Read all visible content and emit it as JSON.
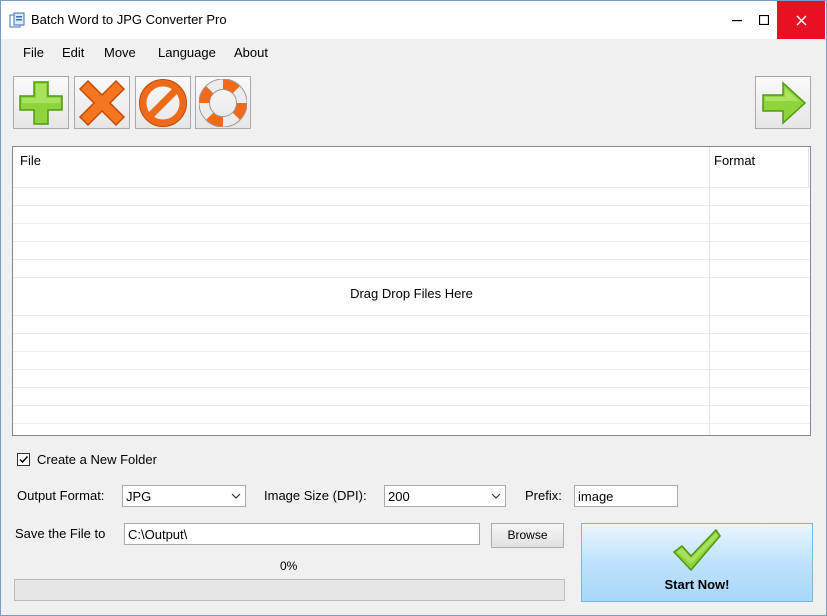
{
  "window": {
    "title": "Batch Word to JPG Converter Pro"
  },
  "menu": [
    "File",
    "Edit",
    "Move",
    "Language",
    "About"
  ],
  "toolbar": {
    "add": "add-icon",
    "remove": "remove-icon",
    "clear": "clear-icon",
    "help": "help-icon",
    "next": "next-arrow-icon"
  },
  "filelist": {
    "columns": [
      "File",
      "Format"
    ],
    "placeholder": "Drag  Drop Files Here"
  },
  "options": {
    "create_folder_label": "Create a New Folder",
    "create_folder_checked": true,
    "output_format_label": "Output Format:",
    "output_format_value": "JPG",
    "image_size_label": "Image Size (DPI):",
    "image_size_value": "200",
    "prefix_label": "Prefix:",
    "prefix_value": "image",
    "save_label": "Save the File to",
    "save_value": "C:\\Output\\",
    "browse_label": "Browse"
  },
  "progress": {
    "text": "0%",
    "value": 0
  },
  "start": {
    "label": "Start Now!"
  },
  "colors": {
    "close": "#e81123",
    "start_bg": "#bfe2fb",
    "accent_green": "#7bc41f",
    "accent_orange": "#f26c1c"
  }
}
